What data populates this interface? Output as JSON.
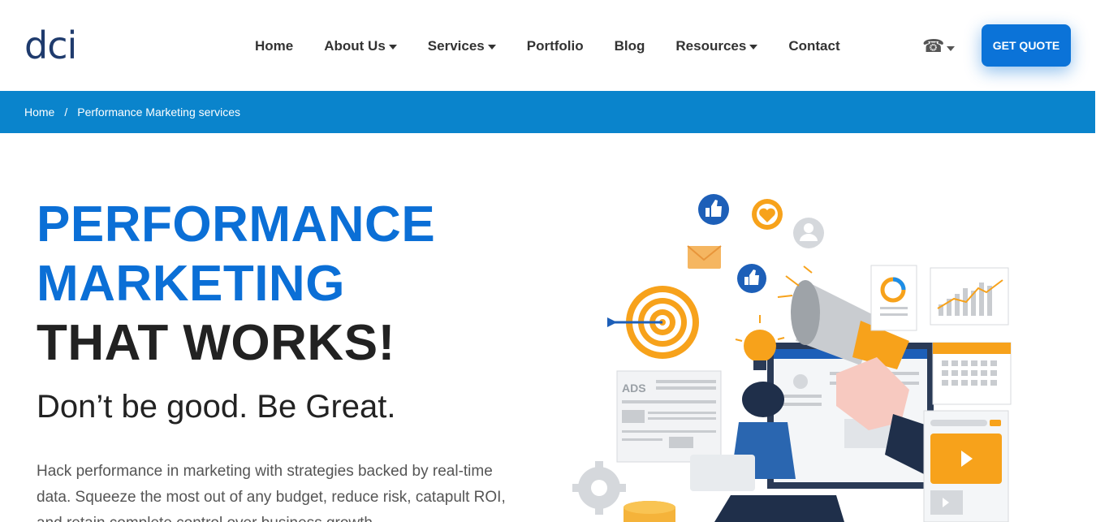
{
  "header": {
    "logo_text": "dci",
    "nav": [
      {
        "label": "Home",
        "dropdown": false
      },
      {
        "label": "About Us",
        "dropdown": true
      },
      {
        "label": "Services",
        "dropdown": true
      },
      {
        "label": "Portfolio",
        "dropdown": false
      },
      {
        "label": "Blog",
        "dropdown": false
      },
      {
        "label": "Resources",
        "dropdown": true
      },
      {
        "label": "Contact",
        "dropdown": false
      }
    ],
    "phone_icon": "☎",
    "quote_button": "GET QUOTE"
  },
  "breadcrumb": {
    "home": "Home",
    "separator": "/",
    "current": "Performance Marketing services"
  },
  "hero": {
    "line1": "PERFORMANCE",
    "line2": "MARKETING",
    "line3": "THAT WORKS!",
    "tagline": "Don’t be good. Be Great.",
    "description": "Hack performance in marketing with strategies backed by real-time data. Squeeze the most out of any budget, reduce risk, catapult ROI, and retain complete control over business growth."
  },
  "illustration": {
    "ads_label": "ADS"
  },
  "colors": {
    "brand_blue": "#0b6fd6",
    "breadcrumb_bg": "#0a84cc",
    "button_bg": "#0b73d8",
    "accent_orange": "#f7a21b"
  }
}
